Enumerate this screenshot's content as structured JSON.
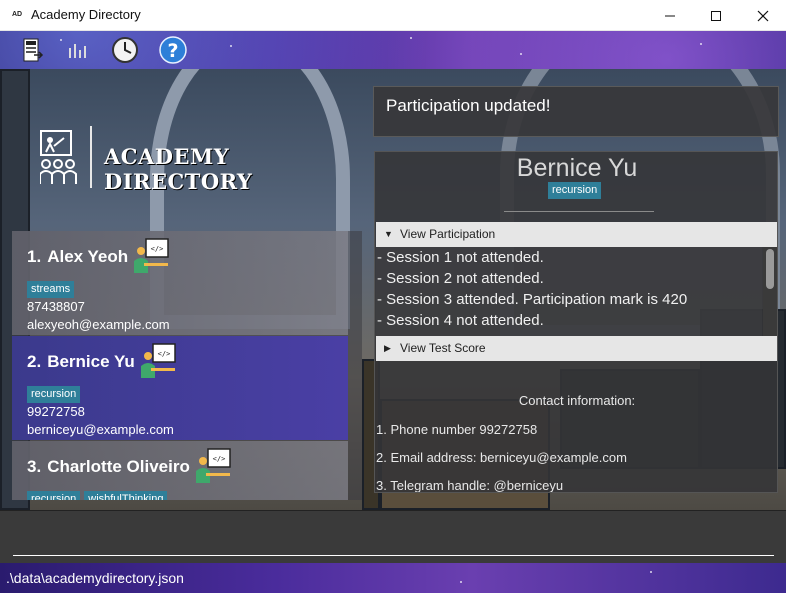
{
  "window": {
    "app_badge": "AD",
    "title": "Academy Directory"
  },
  "toolbar": {
    "buttons": [
      {
        "icon": "exit-icon"
      },
      {
        "icon": "view-icon"
      },
      {
        "icon": "history-icon"
      },
      {
        "icon": "help-icon"
      }
    ]
  },
  "logo": {
    "text": "ACADEMY DIRECTORY",
    "icon": "classroom-icon"
  },
  "students": [
    {
      "index": "1.",
      "name": "Alex Yeoh",
      "tags": [
        "streams"
      ],
      "phone": "87438807",
      "email": "alexyeoh@example.com",
      "selected": false
    },
    {
      "index": "2.",
      "name": "Bernice Yu",
      "tags": [
        "recursion"
      ],
      "phone": "99272758",
      "email": "berniceyu@example.com",
      "selected": true
    },
    {
      "index": "3.",
      "name": "Charlotte Oliveiro",
      "tags": [
        "recursion",
        "wishfulThinking"
      ],
      "phone": "",
      "email": "",
      "selected": false
    }
  ],
  "result_display": {
    "message": "Participation updated!"
  },
  "detail": {
    "name": "Bernice Yu",
    "tag": "recursion",
    "participation_header": "View Participation",
    "participation": [
      "- Session 1 not attended.",
      "- Session 2 not attended.",
      "- Session 3 attended. Participation mark is 420",
      "- Session 4 not attended."
    ],
    "test_score_header": "View Test Score",
    "contact_header": "Contact information:",
    "contact": [
      "1. Phone number 99272758",
      "2. Email address: berniceyu@example.com",
      "3. Telegram handle: @berniceyu"
    ]
  },
  "status": {
    "path": ".\\data\\academydirectory.json"
  },
  "colors": {
    "tag": "#2f7f99",
    "selected_card": "#3b3a8c",
    "toolbar_gradient": "#4a2c9c"
  }
}
